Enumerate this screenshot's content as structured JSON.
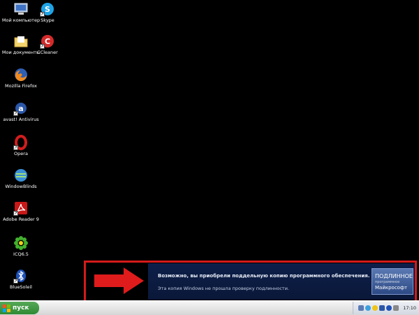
{
  "desktop": {
    "icons": [
      {
        "label": "Мой компьютер",
        "icon": "my-computer-icon"
      },
      {
        "label": "Skype",
        "icon": "skype-icon"
      },
      {
        "label": "Мои документы",
        "icon": "my-documents-icon"
      },
      {
        "label": "CCleaner",
        "icon": "ccleaner-icon"
      },
      {
        "label": "Mozilla Firefox",
        "icon": "firefox-icon"
      },
      {
        "label": "avast! Antivirus",
        "icon": "avast-icon"
      },
      {
        "label": "Opera",
        "icon": "opera-icon"
      },
      {
        "label": "WindowBlinds",
        "icon": "windowblinds-icon"
      },
      {
        "label": "Adobe Reader 9",
        "icon": "adobe-reader-icon"
      },
      {
        "label": "ICQ6.5",
        "icon": "icq-icon"
      },
      {
        "label": "BlueSoleil",
        "icon": "bluesoleil-icon"
      }
    ]
  },
  "notification": {
    "line1": "Возможно, вы приобрели поддельную копию программного обеспечения.",
    "line2": "Эта копия Windows не прошла проверку подлинности.",
    "badge_line1": "ПОДЛИННОЕ",
    "badge_line2": "программное",
    "badge_line3": "Майкрософт",
    "highlight_color": "#d51a1a",
    "arrow_color": "#e01b1b"
  },
  "taskbar": {
    "start_label": "пуск",
    "clock": "17:10"
  }
}
